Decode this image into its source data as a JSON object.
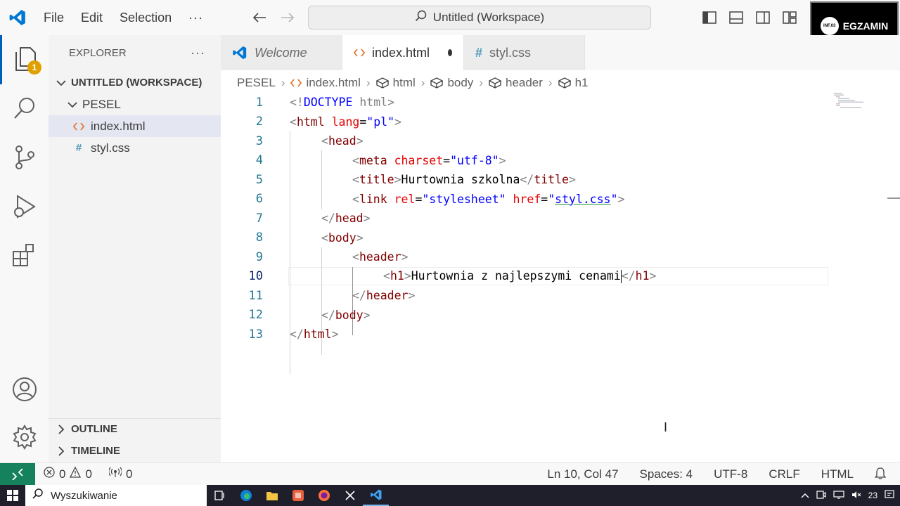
{
  "menu": {
    "file": "File",
    "edit": "Edit",
    "selection": "Selection",
    "more": "···"
  },
  "command_center": {
    "text": "Untitled (Workspace)"
  },
  "badge": {
    "text": "EGZAMIN",
    "circle_text": "INF.03"
  },
  "activity": {
    "explorer_badge": "1"
  },
  "sidebar": {
    "title": "EXPLORER",
    "more": "···",
    "workspace": "UNTITLED (WORKSPACE)",
    "folder": "PESEL",
    "files": [
      {
        "name": "index.html",
        "icon": "html-file-icon"
      },
      {
        "name": "styl.css",
        "icon": "css-file-icon"
      }
    ],
    "outline": "OUTLINE",
    "timeline": "TIMELINE"
  },
  "tabs": [
    {
      "label": "Welcome"
    },
    {
      "label": "index.html"
    },
    {
      "label": "styl.css"
    }
  ],
  "breadcrumb": [
    "PESEL",
    "index.html",
    "html",
    "body",
    "header",
    "h1"
  ],
  "code": {
    "line_numbers": [
      "1",
      "2",
      "3",
      "4",
      "5",
      "6",
      "7",
      "8",
      "9",
      "10",
      "11",
      "12",
      "13"
    ],
    "l1": {
      "a": "<!",
      "b": "DOCTYPE",
      "c": " html",
      "d": ">"
    },
    "l2": {
      "open": "<",
      "tag": "html",
      "attr": " lang",
      "eq": "=",
      "val": "\"pl\"",
      "close": ">"
    },
    "l3": {
      "open": "<",
      "tag": "head",
      "close": ">"
    },
    "l4": {
      "open": "<",
      "tag": "meta",
      "attr": " charset",
      "eq": "=",
      "val": "\"utf-8\"",
      "close": ">"
    },
    "l5": {
      "open": "<",
      "tag": "title",
      "close": ">",
      "text": "Hurtownia szkolna",
      "open2": "</",
      "tag2": "title",
      "close2": ">"
    },
    "l6": {
      "open": "<",
      "tag": "link",
      "attr1": " rel",
      "eq1": "=",
      "val1": "\"stylesheet\"",
      "attr2": " href",
      "eq2": "=",
      "q1": "\"",
      "val2": "styl.css",
      "q2": "\"",
      "close": ">"
    },
    "l7": {
      "open": "</",
      "tag": "head",
      "close": ">"
    },
    "l8": {
      "open": "<",
      "tag": "body",
      "close": ">"
    },
    "l9": {
      "open": "<",
      "tag": "header",
      "close": ">"
    },
    "l10": {
      "open": "<",
      "tag": "h1",
      "close": ">",
      "text": "Hurtownia z najlepszymi cenami",
      "open2": "</",
      "tag2": "h1",
      "close2": ">"
    },
    "l11": {
      "open": "</",
      "tag": "header",
      "close": ">"
    },
    "l12": {
      "open": "</",
      "tag": "body",
      "close": ">"
    },
    "l13": {
      "open": "</",
      "tag": "html",
      "close": ">"
    }
  },
  "status": {
    "errors": "0",
    "warnings": "0",
    "ports": "0",
    "position": "Ln 10, Col 47",
    "spaces": "Spaces: 4",
    "encoding": "UTF-8",
    "eol": "CRLF",
    "language": "HTML"
  },
  "taskbar": {
    "search_placeholder": "Wyszukiwanie",
    "tray_number": "23"
  },
  "colors": {
    "accent": "#005fb8",
    "remote": "#16825d",
    "badge": "#e0a100"
  }
}
